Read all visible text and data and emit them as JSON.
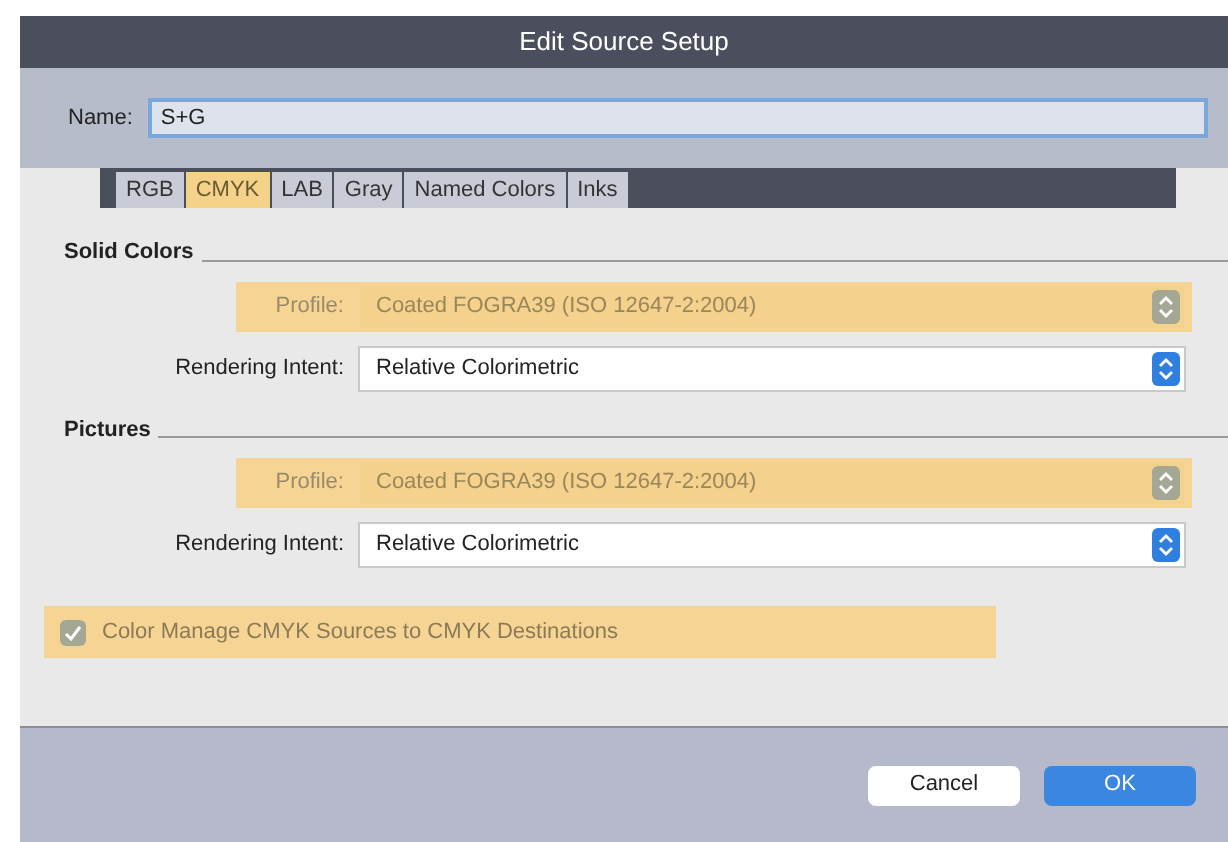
{
  "window": {
    "title": "Edit Source Setup"
  },
  "name_field": {
    "label": "Name:",
    "value": "S+G"
  },
  "tabs": [
    {
      "label": "RGB",
      "selected": false
    },
    {
      "label": "CMYK",
      "selected": true
    },
    {
      "label": "LAB",
      "selected": false
    },
    {
      "label": "Gray",
      "selected": false
    },
    {
      "label": "Named Colors",
      "selected": false
    },
    {
      "label": "Inks",
      "selected": false
    }
  ],
  "sections": [
    {
      "title": "Solid Colors",
      "rows": [
        {
          "label": "Profile:",
          "value": "Coated FOGRA39 (ISO 12647-2:2004)",
          "disabled": true,
          "highlighted": true
        },
        {
          "label": "Rendering Intent:",
          "value": "Relative Colorimetric",
          "disabled": false,
          "highlighted": false
        }
      ]
    },
    {
      "title": "Pictures",
      "rows": [
        {
          "label": "Profile:",
          "value": "Coated FOGRA39 (ISO 12647-2:2004)",
          "disabled": true,
          "highlighted": true
        },
        {
          "label": "Rendering Intent:",
          "value": "Relative Colorimetric",
          "disabled": false,
          "highlighted": false
        }
      ]
    }
  ],
  "checkbox": {
    "label": "Color Manage CMYK Sources to CMYK Destinations",
    "checked": true,
    "disabled": true,
    "highlighted": true
  },
  "buttons": [
    {
      "label": "Cancel",
      "kind": "secondary"
    },
    {
      "label": "OK",
      "kind": "primary"
    }
  ]
}
